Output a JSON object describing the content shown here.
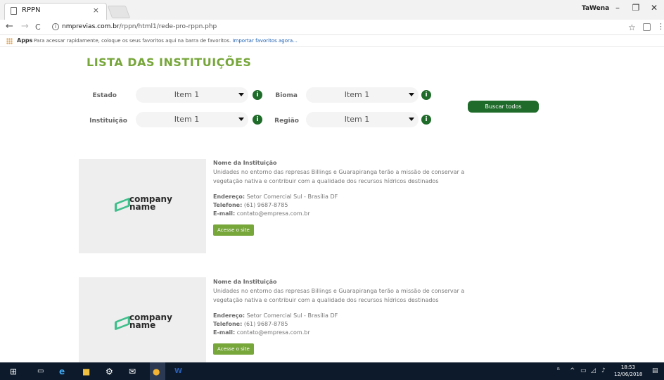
{
  "browser": {
    "tab_title": "RPPN",
    "tab_close": "×",
    "user": "TaWena",
    "win_minimize": "–",
    "win_restore": "❐",
    "win_close": "✕",
    "back": "←",
    "forward": "→",
    "reload": "C",
    "url_domain": "nmprevias.com.br",
    "url_path": "/rppn/html1/rede-pro-rppn.php",
    "bookmarks_apps": "Apps",
    "bookmarks_hint": "Para acessar rapidamente, coloque os seus favoritos aqui na barra de favoritos.",
    "bookmarks_import": "Importar favoritos agora..."
  },
  "page": {
    "title": "LISTA DAS INSTITUIÇÕES",
    "filters": {
      "estado_label": "Estado",
      "estado_value": "Item 1",
      "bioma_label": "Bioma",
      "bioma_value": "Item 1",
      "instituicao_label": "Instituição",
      "instituicao_value": "Item 1",
      "regiao_label": "Região",
      "regiao_value": "Item 1",
      "info": "i",
      "search_all": "Buscar todos"
    },
    "cards": [
      {
        "logo_line1": "company",
        "logo_line2": "name",
        "name": "Nome da Instituição",
        "desc": "Unidades no entorno das represas Billings e Guarapiranga terão a missão de conservar a vegetação nativa e contribuir com a qualidade dos recursos hídricos destinados",
        "address_label": "Endereço:",
        "address": "Setor Comercial Sul - Brasília DF",
        "phone_label": "Telefone:",
        "phone": "(61) 9687-8785",
        "email_label": "E-mail:",
        "email": "contato@empresa.com.br",
        "button": "Acesse o site"
      },
      {
        "logo_line1": "company",
        "logo_line2": "name",
        "name": "Nome da Instituição",
        "desc": "Unidades no entorno das represas Billings e Guarapiranga terão a missão de conservar a vegetação nativa e contribuir com a qualidade dos recursos hídricos destinados",
        "address_label": "Endereço:",
        "address": "Setor Comercial Sul - Brasília DF",
        "phone_label": "Telefone:",
        "phone": "(61) 9687-8785",
        "email_label": "E-mail:",
        "email": "contato@empresa.com.br",
        "button": "Acesse o site"
      }
    ]
  },
  "taskbar": {
    "time": "18:53",
    "date": "12/06/2018"
  },
  "colors": {
    "accent_green": "#77a63b",
    "dark_green": "#1f6b2a",
    "taskbar": "#0d1a2b"
  }
}
